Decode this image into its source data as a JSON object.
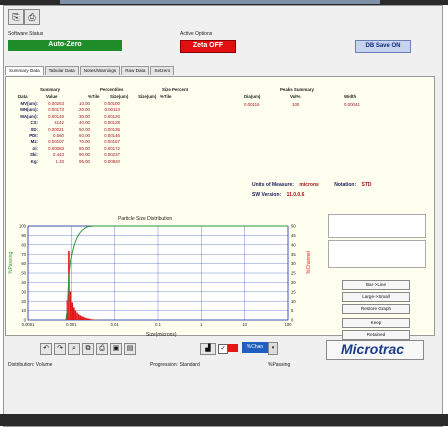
{
  "window": {
    "title": ""
  },
  "status": {
    "label": "Software Status",
    "auto_zero": "Auto-Zero",
    "active_options_label": "Active Options",
    "zeta": "Zeta OFF",
    "db_save": "DB Save ON"
  },
  "tabs": [
    "Summary Data",
    "Tabular Data",
    "Notes/Warnings",
    "Raw Data",
    "Setzero"
  ],
  "summary": {
    "title": "Summary",
    "cols": [
      "Data",
      "Value"
    ],
    "rows": [
      {
        "name": "MV(um):",
        "value": "0.00263"
      },
      {
        "name": "MN(um):",
        "value": "0.00173"
      },
      {
        "name": "MA(um):",
        "value": "0.00149"
      },
      {
        "name": "CS:",
        "value": "4142"
      },
      {
        "name": "SD:",
        "value": "0.00021"
      },
      {
        "name": "PDI:",
        "value": "0.560"
      },
      {
        "name": "Mz:",
        "value": "0.00107"
      },
      {
        "name": "σi:",
        "value": "0.00083"
      },
      {
        "name": "Ski:",
        "value": "0.443"
      },
      {
        "name": "Kg:",
        "value": "1.33"
      }
    ]
  },
  "percentiles": {
    "title": "Percentiles",
    "cols": [
      "%Tile",
      "Size(um)"
    ],
    "rows": [
      {
        "p": "10.00",
        "s": "0.00100"
      },
      {
        "p": "20.00",
        "s": "0.00113"
      },
      {
        "p": "30.00",
        "s": "0.00120"
      },
      {
        "p": "40.00",
        "s": "0.00128"
      },
      {
        "p": "50.00",
        "s": "0.00136"
      },
      {
        "p": "60.00",
        "s": "0.00146"
      },
      {
        "p": "70.00",
        "s": "0.00157"
      },
      {
        "p": "80.00",
        "s": "0.00172"
      },
      {
        "p": "90.00",
        "s": "0.00237"
      },
      {
        "p": "95.00",
        "s": "0.00820"
      }
    ]
  },
  "size_percent": {
    "title": "Size Percent",
    "cols": [
      "Size(um)",
      "%Tile"
    ]
  },
  "peaks": {
    "title": "Peaks Summary",
    "cols": [
      "Dia(um)",
      "Vol%",
      "Width"
    ],
    "row": {
      "dia": "0.00116",
      "vol": "100",
      "width": "0.00041"
    }
  },
  "units": {
    "label": "Units of Measure:",
    "value": "microns",
    "notation_label": "Notation:",
    "notation_value": "STD",
    "sw_label": "SW Version:",
    "sw_value": "11.0.0.6"
  },
  "chart_data": {
    "type": "bar",
    "title": "Particle Size Distribution",
    "xlabel": "Size(microns)",
    "ylabel": "%Passing",
    "y2label": "%Channel",
    "xscale": "log",
    "xlim": [
      0.0001,
      100
    ],
    "ylim": [
      0,
      100
    ],
    "y2lim": [
      0,
      50
    ],
    "xticks": [
      "0.0001",
      "0.001",
      "0.01",
      "0.1",
      "1",
      "10",
      "100"
    ],
    "yticks": [
      "0",
      "10",
      "20",
      "30",
      "40",
      "50",
      "60",
      "70",
      "80",
      "90",
      "100"
    ],
    "y2ticks": [
      "0",
      "5",
      "10",
      "15",
      "20",
      "25",
      "30",
      "35",
      "40",
      "45",
      "50"
    ],
    "bars": {
      "x": [
        0.00081,
        0.00088,
        0.00096,
        0.00105,
        0.00114,
        0.00124,
        0.00135,
        0.00147,
        0.0016,
        0.00175,
        0.0019,
        0.00207,
        0.00226,
        0.00246,
        0.00268,
        0.00292,
        0.00319,
        0.00347,
        0.00378,
        0.00412
      ],
      "values": [
        10.5,
        36.7,
        15.2,
        9.3,
        6.7,
        5.1,
        3.9,
        3.1,
        2.5,
        2.0,
        1.6,
        1.3,
        1.0,
        0.8,
        0.6,
        0.4,
        0.3,
        0.2,
        0.15,
        0.1
      ]
    },
    "cumulative": {
      "x": [
        0.00075,
        0.00081,
        0.00088,
        0.00096,
        0.00105,
        0.00114,
        0.00124,
        0.00135,
        0.00147,
        0.0016,
        0.00175,
        0.0019,
        0.00207,
        0.00226,
        0.00246,
        0.00268,
        0.00292,
        0.00319,
        0.00347,
        0.00378,
        0.00412,
        0.01,
        1,
        100
      ],
      "values": [
        0,
        10.5,
        47.2,
        62.4,
        71.7,
        78.4,
        83.5,
        87.4,
        90.5,
        93.0,
        95.0,
        96.6,
        97.9,
        98.9,
        99.4,
        99.6,
        99.8,
        99.9,
        99.95,
        99.98,
        100,
        100,
        100,
        100
      ]
    },
    "colors": {
      "bars": "#e11818",
      "cumulative": "#2b9a3a",
      "grid": "#1f3ba8"
    }
  },
  "side_buttons": [
    "Bar->Line",
    "Large->Small",
    "Restore Graph",
    "Keep",
    "Retained"
  ],
  "toolbar_bottom": {
    "icons": [
      "undo-icon",
      "redo-icon",
      "zoom-icon",
      "copy-icon",
      "print-icon",
      "save-icon",
      "image-icon"
    ],
    "channel": "%Chan",
    "checkbox_color": "#e11818"
  },
  "footer": {
    "left_label": "Distribution: Volume",
    "middle_label": "Progression: Standard",
    "right_label": "%Passing"
  },
  "logo": "Microtrac"
}
